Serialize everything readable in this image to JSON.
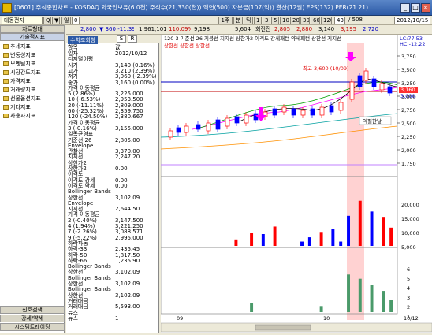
{
  "window": {
    "title": "[0601] 주식종합차트 - KOSDAQ 외국인보유(6.0천) 주식수(21,330(천)) 액면(500) 자본금(107(억)) 결산(12월) EPS(132) PER(21.21)"
  },
  "toolbar": {
    "code_input": "대동전자",
    "btn_search": "Q",
    "btn_down": "▼",
    "type_label": "일",
    "dot": "0",
    "period_label": "1주",
    "minute_label": "분",
    "tick_label": "틱",
    "mins": [
      "1",
      "3",
      "5",
      "10",
      "20",
      "30",
      "60",
      "120"
    ],
    "date_field": "43",
    "count": "/ 508",
    "date": "2012/10/15"
  },
  "toolbar2": {
    "price": "2,800",
    "change": "▼ 360 -11.39%",
    "v1": "1,961,101",
    "v2": "110.09%",
    "v3": "9,198",
    "v4": "5,604",
    "fin1": "2,805",
    "fin2": "2,880",
    "fin3": "3,140",
    "fin4": "3,195",
    "fin5": "2,720",
    "rate1": "억",
    "rate2": "회전전",
    "lbl_a": "주식",
    "lbl_b": "보조",
    "chart_type": "디지털이평",
    "add": "주봉",
    "sub": "분석",
    "num": "5"
  },
  "left_panel": {
    "header": "차트형태",
    "sub": "기술적지표",
    "items": [
      "추세지표",
      "변동성지표",
      "모멘텀지표",
      "시장강도지표",
      "가격지표",
      "거래량지표",
      "선물옵션지표",
      "기타지표",
      "사용자지표"
    ],
    "footer": [
      "신호검색",
      "강세/약세",
      "시스템트레이딩"
    ]
  },
  "info_panel": {
    "title": "수치조회창",
    "tab_s": "S",
    "tab_r": "R",
    "head_item": "항목",
    "head_value": "값",
    "rows": [
      [
        "일자",
        "2012/10/12"
      ],
      [
        "디지털이평",
        ""
      ],
      [
        "  시가",
        "3,140 (0.16%)"
      ],
      [
        "  고가",
        "3,210 (2.39%)"
      ],
      [
        "  저가",
        "3,060 (-2.39%)"
      ],
      [
        "  종가",
        "3,160 (0.00%)"
      ],
      [
        "가격 이동평균",
        ""
      ],
      [
        "  5 (2.86%)",
        "3,225.000"
      ],
      [
        "  10 (-6.53%)",
        "2,953.500"
      ],
      [
        "  20 (-11.11%)",
        "2,809.000"
      ],
      [
        "  60 (-25.32%)",
        "2,359.750"
      ],
      [
        "  120 (-24.50%)",
        "2,380.667"
      ],
      [
        "가격 이동평균",
        ""
      ],
      [
        "  3 (-0.16%)",
        "3,155.000"
      ],
      [
        "일목균형표",
        ""
      ],
      [
        "  기준선 26",
        "2,805.00"
      ],
      [
        "Envelope",
        ""
      ],
      [
        "  관찰선",
        "3,370.00"
      ],
      [
        "  지지선",
        "2,247.20"
      ],
      [
        "상한가2",
        ""
      ],
      [
        "  상한가2",
        "0.00"
      ],
      [
        "이격도",
        ""
      ],
      [
        "  이격도 강세",
        "0.00"
      ],
      [
        "  이격도 약세",
        "0.00"
      ],
      [
        "Bollinger Bands",
        ""
      ],
      [
        "  상한선",
        "3,102.09"
      ],
      [
        "Envelope",
        ""
      ],
      [
        "  지지선",
        "2,644.50"
      ],
      [
        "가격 이동평균",
        ""
      ],
      [
        "  2 (-0.40%)",
        "3,147.500"
      ],
      [
        "  4 (1.94%)",
        "3,221.250"
      ],
      [
        "  7 (-2.26%)",
        "3,088.571"
      ],
      [
        "  9 (-5.22%)",
        "2,995.000"
      ],
      [
        "하락파동",
        ""
      ],
      [
        "  하락-33",
        "2,435.45"
      ],
      [
        "  하락-50",
        "1,817.50"
      ],
      [
        "  하락-66",
        "1,235.90"
      ],
      [
        "Bollinger Bands",
        ""
      ],
      [
        "  상한선",
        "3,102.09"
      ],
      [
        "Bollinger Bands",
        ""
      ],
      [
        "  상한선",
        "3,102.09"
      ],
      [
        "Bollinger Bands",
        ""
      ],
      [
        "  상한선",
        "3,102.09"
      ],
      [
        "거래대금",
        ""
      ],
      [
        "  거래대금",
        "5,593.00"
      ],
      [
        "뉴스",
        ""
      ],
      [
        "  뉴스",
        "1"
      ]
    ]
  },
  "chart_legend": "120  3  기준선 26  지붕선  지지선  상한가2  이격도 강세패턴  약세패턴  상한선  지지선",
  "chart_legend2": "상한선  상한선  상한선",
  "price_annotation": "최고 3,600 (10/09)",
  "tooltip": "익절한날",
  "price_axis": [
    "3,750",
    "3,500",
    "3,250",
    "3,000",
    "2,750",
    "2,500",
    "2,250",
    "2,000",
    "1,750"
  ],
  "price_tags": {
    "lc": "LC:77.53",
    "hc": "HC:-12.22",
    "cur": "3,160",
    "mid": "3,000"
  },
  "vol_axis": [
    "20,000",
    "15,000",
    "10,000",
    "5,000"
  ],
  "amt_axis": [
    "6",
    "5",
    "4",
    "3",
    "2",
    "1"
  ],
  "x_labels": [
    "09",
    "10",
    "10/12"
  ],
  "colors": {
    "accent": "#1c4fa0",
    "up": "#ff0000",
    "down": "#0000ff",
    "ma": "#00a000",
    "highlight": "#ffd2d2"
  },
  "chart_data": {
    "type": "bar",
    "title": "",
    "volume_values": [
      0,
      0,
      0,
      0,
      0,
      0,
      0,
      0,
      0,
      0,
      0,
      0,
      0,
      0,
      0,
      0,
      0,
      0,
      0,
      3000,
      0,
      0,
      0,
      6000,
      0,
      0,
      5500,
      0,
      0,
      9000,
      0,
      0,
      0,
      0,
      0,
      0,
      2000,
      0,
      4000,
      0,
      0,
      6500,
      0,
      0,
      8000,
      0,
      2000,
      0,
      14000,
      0,
      0,
      21000,
      0,
      0,
      16000,
      0,
      0,
      13500,
      0,
      8500,
      0
    ],
    "amount_values": [
      0,
      0,
      0,
      0,
      0,
      0,
      0,
      0,
      0,
      0,
      0,
      0,
      0,
      0,
      0,
      0,
      0,
      0,
      0,
      0,
      0,
      0,
      0,
      1.5,
      0,
      0,
      0,
      0,
      0,
      0,
      0,
      0,
      0,
      0,
      0,
      0,
      0,
      0,
      0,
      0,
      0,
      1,
      0,
      0,
      0,
      0,
      0,
      0,
      6.2,
      0,
      0,
      5.5,
      0,
      0,
      4.5,
      0,
      0,
      3.5,
      0,
      2,
      0
    ]
  }
}
